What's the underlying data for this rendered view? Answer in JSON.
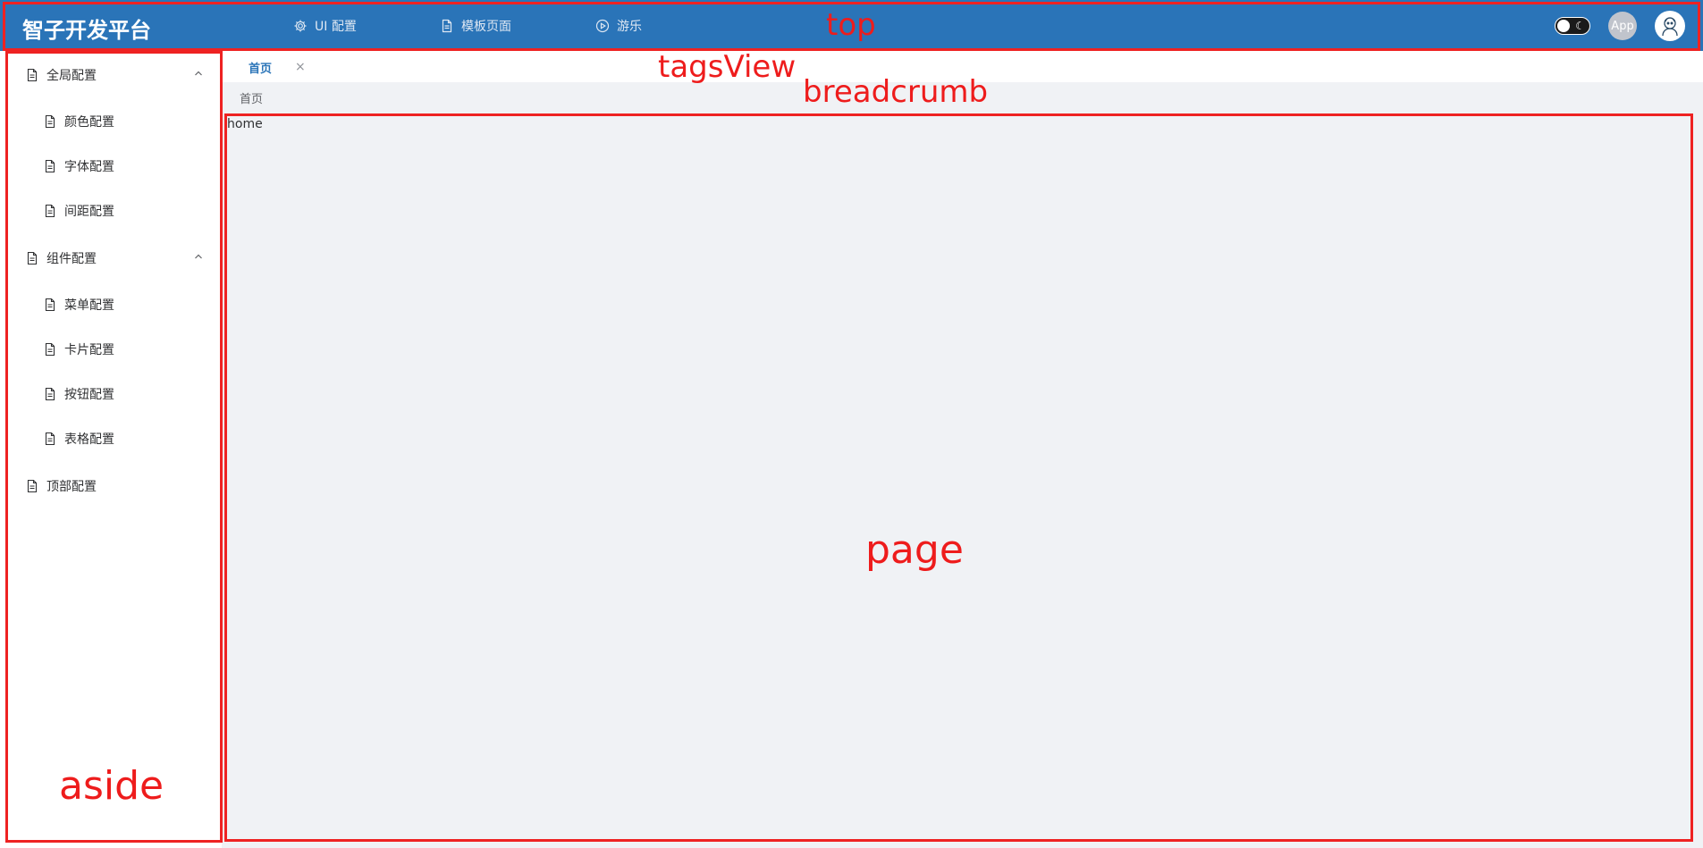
{
  "top": {
    "logo": "智子开发平台",
    "nav": [
      {
        "label": "UI 配置",
        "icon": "gear-icon"
      },
      {
        "label": "模板页面",
        "icon": "document-icon"
      },
      {
        "label": "游乐",
        "icon": "play-icon"
      }
    ],
    "app_badge": "App",
    "theme_toggle_icon": "moon-icon",
    "avatar_icon": "avatar-icon"
  },
  "aside": {
    "groups": [
      {
        "label": "全局配置",
        "items": [
          "颜色配置",
          "字体配置",
          "间距配置"
        ]
      },
      {
        "label": "组件配置",
        "items": [
          "菜单配置",
          "卡片配置",
          "按钮配置",
          "表格配置"
        ]
      },
      {
        "label": "顶部配置",
        "items": []
      }
    ]
  },
  "tags": {
    "active_tag": "首页",
    "close_glyph": "×"
  },
  "breadcrumb": {
    "current": "首页"
  },
  "page": {
    "content": "home"
  },
  "annotations": {
    "top": "top",
    "tagsView": "tagsView",
    "breadcrumb": "breadcrumb",
    "page": "page",
    "aside": "aside"
  },
  "colors": {
    "header_bg": "#2a74b8",
    "annotation_red": "#ee2222",
    "content_bg": "#f0f2f5"
  }
}
